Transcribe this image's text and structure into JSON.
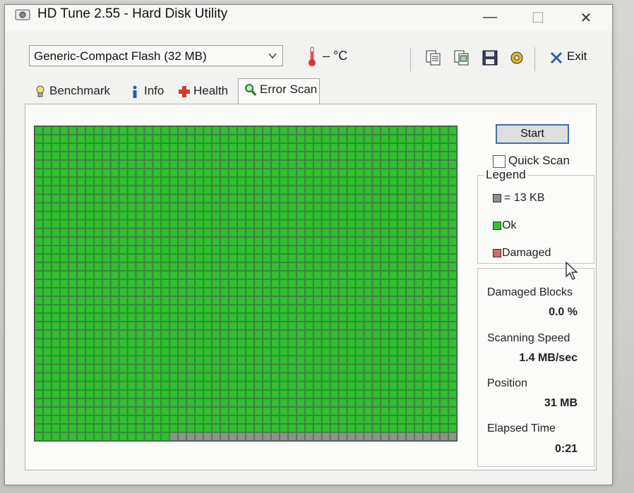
{
  "window": {
    "title": "HD Tune 2.55 - Hard Disk Utility"
  },
  "toolbar": {
    "drive": "Generic-Compact Flash (32 MB)",
    "temperature": "– °C",
    "exit_label": "Exit"
  },
  "tabs": [
    {
      "label": "Benchmark",
      "icon": "lightbulb-icon"
    },
    {
      "label": "Info",
      "icon": "info-icon"
    },
    {
      "label": "Health",
      "icon": "health-cross-icon"
    },
    {
      "label": "Error Scan",
      "icon": "magnifier-icon",
      "active": true
    }
  ],
  "scan": {
    "start_label": "Start",
    "quick_scan_label": "Quick Scan",
    "quick_scan_checked": false,
    "grid": {
      "cols": 50,
      "rows": 37,
      "scanned_blocks": 1816,
      "total_blocks": 1850
    },
    "colors": {
      "ok": "#2fc12f",
      "damaged": "#d46a6a",
      "unscanned": "#8f8f8f"
    }
  },
  "legend": {
    "title": "Legend",
    "block_size": "= 13 KB",
    "ok": "Ok",
    "damaged": "Damaged"
  },
  "stats": {
    "damaged_blocks_label": "Damaged Blocks",
    "damaged_blocks_value": "0.0 %",
    "scanning_speed_label": "Scanning Speed",
    "scanning_speed_value": "1.4 MB/sec",
    "position_label": "Position",
    "position_value": "31 MB",
    "elapsed_label": "Elapsed Time",
    "elapsed_value": "0:21"
  }
}
